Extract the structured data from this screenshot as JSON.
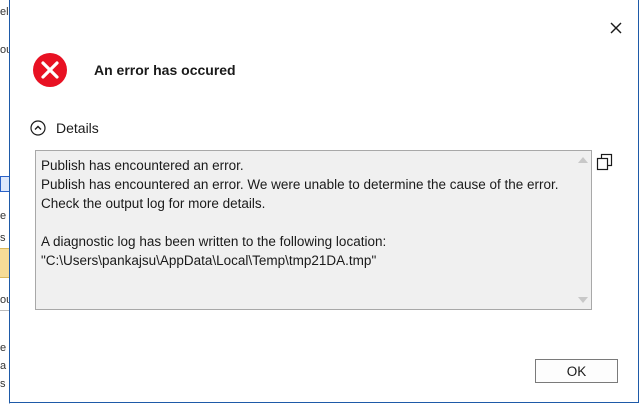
{
  "background_app": {
    "fragments": [
      "el",
      "ou",
      "e",
      "s",
      "ou",
      "e",
      "a",
      "s"
    ]
  },
  "dialog": {
    "heading": "An error has occured",
    "details_toggle_label": "Details",
    "details_text": "Publish has encountered an error.\nPublish has encountered an error. We were unable to determine the cause of the error. Check the output log for more details.\n\nA diagnostic log has been written to the following location:\n\"C:\\Users\\pankajsu\\AppData\\Local\\Temp\\tmp21DA.tmp\"",
    "ok_label": "OK",
    "close_glyph": "✕"
  },
  "icons": {
    "error": "error-circle-icon",
    "close": "close-icon",
    "collapse": "chevron-up-circle-icon",
    "copy": "copy-icon"
  },
  "colors": {
    "error_red": "#e81123",
    "border_blue": "#1e5aa8"
  }
}
